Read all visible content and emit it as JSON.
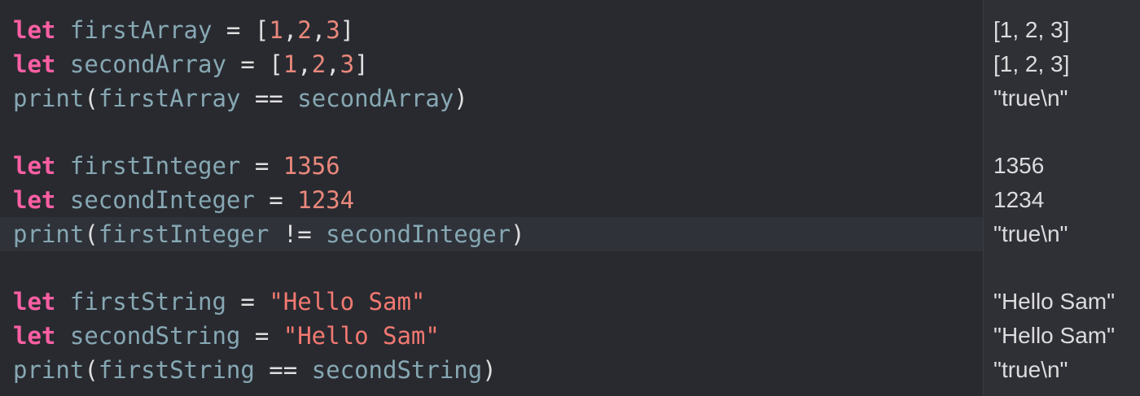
{
  "colors": {
    "background": "#292a30",
    "results_background": "#2f3036",
    "keyword": "#fc5fa3",
    "identifier": "#86a8b3",
    "number": "#e9887b",
    "string": "#f27971",
    "plain": "#dfdfe0"
  },
  "code": [
    {
      "tokens": [
        [
          "kw",
          "let"
        ],
        [
          "pl",
          " "
        ],
        [
          "id",
          "firstArray"
        ],
        [
          "pl",
          " = ["
        ],
        [
          "num",
          "1"
        ],
        [
          "pl",
          ","
        ],
        [
          "num",
          "2"
        ],
        [
          "pl",
          ","
        ],
        [
          "num",
          "3"
        ],
        [
          "pl",
          "]"
        ]
      ],
      "result": "[1, 2, 3]"
    },
    {
      "tokens": [
        [
          "kw",
          "let"
        ],
        [
          "pl",
          " "
        ],
        [
          "id",
          "secondArray"
        ],
        [
          "pl",
          " = ["
        ],
        [
          "num",
          "1"
        ],
        [
          "pl",
          ","
        ],
        [
          "num",
          "2"
        ],
        [
          "pl",
          ","
        ],
        [
          "num",
          "3"
        ],
        [
          "pl",
          "]"
        ]
      ],
      "result": "[1, 2, 3]"
    },
    {
      "tokens": [
        [
          "fn",
          "print"
        ],
        [
          "pl",
          "("
        ],
        [
          "id",
          "firstArray"
        ],
        [
          "pl",
          " == "
        ],
        [
          "id",
          "secondArray"
        ],
        [
          "pl",
          ")"
        ]
      ],
      "result": "\"true\\n\""
    },
    {
      "tokens": [],
      "result": ""
    },
    {
      "tokens": [
        [
          "kw",
          "let"
        ],
        [
          "pl",
          " "
        ],
        [
          "id",
          "firstInteger"
        ],
        [
          "pl",
          " = "
        ],
        [
          "num",
          "1356"
        ]
      ],
      "result": "1356"
    },
    {
      "tokens": [
        [
          "kw",
          "let"
        ],
        [
          "pl",
          " "
        ],
        [
          "id",
          "secondInteger"
        ],
        [
          "pl",
          " = "
        ],
        [
          "num",
          "1234"
        ]
      ],
      "result": "1234"
    },
    {
      "tokens": [
        [
          "fn",
          "print"
        ],
        [
          "pl",
          "("
        ],
        [
          "id",
          "firstInteger"
        ],
        [
          "pl",
          " != "
        ],
        [
          "id",
          "secondInteger"
        ],
        [
          "pl",
          ")"
        ]
      ],
      "result": "\"true\\n\"",
      "current": true
    },
    {
      "tokens": [],
      "result": ""
    },
    {
      "tokens": [
        [
          "kw",
          "let"
        ],
        [
          "pl",
          " "
        ],
        [
          "id",
          "firstString"
        ],
        [
          "pl",
          " = "
        ],
        [
          "str",
          "\"Hello Sam\""
        ]
      ],
      "result": "\"Hello Sam\""
    },
    {
      "tokens": [
        [
          "kw",
          "let"
        ],
        [
          "pl",
          " "
        ],
        [
          "id",
          "secondString"
        ],
        [
          "pl",
          " = "
        ],
        [
          "str",
          "\"Hello Sam\""
        ]
      ],
      "result": "\"Hello Sam\""
    },
    {
      "tokens": [
        [
          "fn",
          "print"
        ],
        [
          "pl",
          "("
        ],
        [
          "id",
          "firstString"
        ],
        [
          "pl",
          " == "
        ],
        [
          "id",
          "secondString"
        ],
        [
          "pl",
          ")"
        ]
      ],
      "result": "\"true\\n\""
    }
  ]
}
